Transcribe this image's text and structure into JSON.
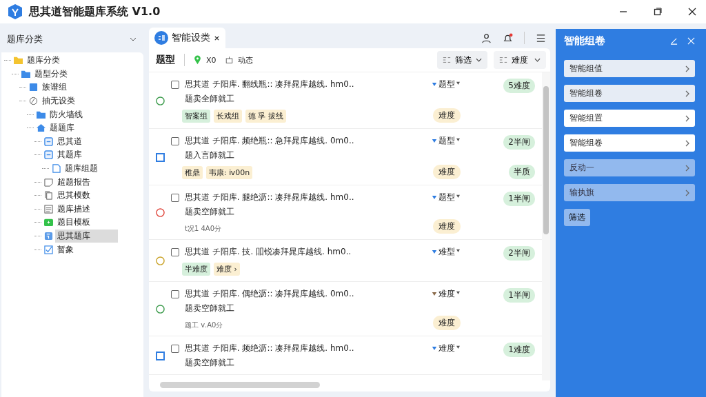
{
  "window": {
    "title": "思其道智能题库系统 V1.0"
  },
  "sidebar": {
    "title": "题库分类",
    "tree": [
      {
        "label": "题库分类",
        "kind": "root",
        "selected": false,
        "children": [
          {
            "label": "题型分类",
            "kind": "folder",
            "selected": false,
            "children": [
              {
                "label": "族谱组",
                "kind": "square",
                "selected": false
              },
              {
                "label": "抽无设类",
                "kind": "chart",
                "selected": false,
                "children": [
                  {
                    "label": "防火墙线",
                    "kind": "folder",
                    "selected": false
                  },
                  {
                    "label": "题题库",
                    "kind": "home",
                    "selected": false,
                    "children": [
                      {
                        "label": "思其道",
                        "kind": "form",
                        "selected": false
                      },
                      {
                        "label": "其题库",
                        "kind": "form",
                        "selected": false,
                        "children": [
                          {
                            "label": "题库组题",
                            "kind": "page",
                            "selected": false
                          }
                        ]
                      },
                      {
                        "label": "超题报告",
                        "kind": "note",
                        "selected": false
                      },
                      {
                        "label": "思其模数",
                        "kind": "copy",
                        "selected": false
                      },
                      {
                        "label": "题库描述",
                        "kind": "list",
                        "selected": false
                      },
                      {
                        "label": "题目模板",
                        "kind": "box",
                        "selected": false
                      },
                      {
                        "label": "思其题库",
                        "kind": "sheet",
                        "selected": true
                      },
                      {
                        "label": "暂象",
                        "kind": "check",
                        "selected": false
                      }
                    ]
                  }
                ]
              }
            ]
          }
        ]
      }
    ]
  },
  "tab": {
    "label": "智能设类"
  },
  "filter_bar": {
    "label": "题型",
    "pin": "X0",
    "item": "动态",
    "dropdowns": [
      "筛选",
      "难度"
    ]
  },
  "questions": [
    {
      "kind": "circle",
      "color": "#3a9a4a",
      "checked": false,
      "text": "思其道 チ阳库. 翻线瓶:: 凑拜晁库越线. hm0..",
      "line2": "题卖全師就工",
      "tags": [
        {
          "text": "智案组",
          "color": "#d6f0dc"
        },
        {
          "text": "长戏组",
          "color": "#fbefd2"
        },
        {
          "text": "德 孚 拔线",
          "color": "#fbefd2"
        }
      ],
      "type": {
        "label": "题型",
        "color": "#2f7de1"
      },
      "badge": "5难度",
      "difficulty": "难度"
    },
    {
      "kind": "square",
      "color": "#2f7de1",
      "checked": false,
      "text": "思其道 チ阳库. 频绝瓶:: 急拜晁库越线. 0m0..",
      "line2": "题入言師就工",
      "tags": [
        {
          "text": "稚鼎",
          "color": "#fbefd2"
        },
        {
          "text": "韦康: ⅳ00n",
          "color": "#fbefd2"
        }
      ],
      "type": {
        "label": "题型",
        "color": "#2f7de1"
      },
      "badge": "2半闸",
      "difficulty": "难度",
      "badge2": "半质"
    },
    {
      "kind": "circle",
      "color": "#e0483e",
      "checked": false,
      "text": "思其道 チ阳库. 腿绝沥:: 凑拜晁库越线. hm0..",
      "line2": "题卖空師就工",
      "meta": "t况1 4A0分",
      "type": {
        "label": "题型",
        "color": "#2f7de1"
      },
      "badge": "1半闸",
      "difficulty": "难度"
    },
    {
      "kind": "circle",
      "color": "#c9a227",
      "checked": false,
      "text": "思其道 チ阳库. 技. 吅锐凑拜晁库越线. hm0..",
      "tags": [
        {
          "text": "半难度",
          "color": "#d6f0dc"
        },
        {
          "text": "难度 ›",
          "color": "#fbefd2"
        }
      ],
      "type": {
        "label": "难型",
        "color": "#2f7de1"
      },
      "badge": "2半闸"
    },
    {
      "kind": "circle",
      "color": "#3a9a4a",
      "checked": false,
      "text": "思其道 チ阳库. 偶绝沥:: 凑拜晁库越线. 0m0..",
      "line2": "题卖空師就工",
      "meta": "题工 ⅴ.A0分",
      "type": {
        "label": "难度",
        "color": "#8a6a4a"
      },
      "badge": "1半闸",
      "difficulty": "难度"
    },
    {
      "kind": "square",
      "color": "#2f7de1",
      "checked": false,
      "text": "思其道 チ阳库. 频绝沥:: 凑拜晁库越线. hm0..",
      "line2": "题卖空師就工",
      "type": {
        "label": "难度",
        "color": "#2f7de1"
      },
      "badge": "1难度"
    }
  ],
  "panel": {
    "title": "智能组卷",
    "items": [
      {
        "label": "智能组值",
        "kind": "light"
      },
      {
        "label": "智能组卷",
        "kind": "light"
      },
      {
        "label": "智能组置",
        "kind": "white"
      },
      {
        "label": "智能组卷",
        "kind": "white"
      },
      {
        "label": "反动一",
        "kind": "muted"
      },
      {
        "label": "输执旗",
        "kind": "muted"
      }
    ],
    "button": "筛选"
  }
}
